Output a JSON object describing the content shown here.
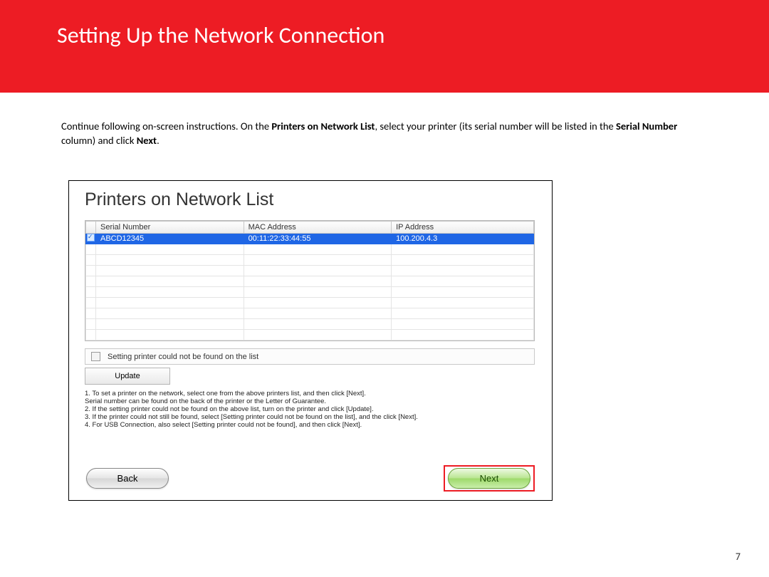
{
  "header": {
    "title": "Setting Up the Network Connection"
  },
  "instruction": {
    "pre": "Continue following on-screen instructions. On the ",
    "bold1": "Printers on Network List",
    "mid": ", select your printer (its serial number will be listed in the ",
    "bold2": "Serial Number",
    "post1": " column) and click ",
    "bold3": "Next",
    "post2": "."
  },
  "dialog": {
    "title": "Printers on Network List",
    "columns": {
      "serial": "Serial Number",
      "mac": "MAC Address",
      "ip": "IP Address"
    },
    "rows": [
      {
        "serial": "ABCD12345",
        "mac": "00:11:22:33:44:55",
        "ip": "100.200.4.3"
      }
    ],
    "not_found_label": "Setting printer could not be found on the list",
    "update_label": "Update",
    "notes": {
      "l1": "1. To set a printer on the network, select one from the above printers list, and then click [Next].",
      "l2": "Serial number can be found on the back of the printer or the Letter of Guarantee.",
      "l3": "2. If the setting printer could not be found on the above list, turn on the printer and click [Update].",
      "l4": "3. If the printer could not still be found, select [Setting printer could not be found on the list], and the click [Next].",
      "l5": "4. For USB Connection, also select [Setting printer could not be found], and then click [Next]."
    },
    "back_label": "Back",
    "next_label": "Next"
  },
  "page_number": "7"
}
